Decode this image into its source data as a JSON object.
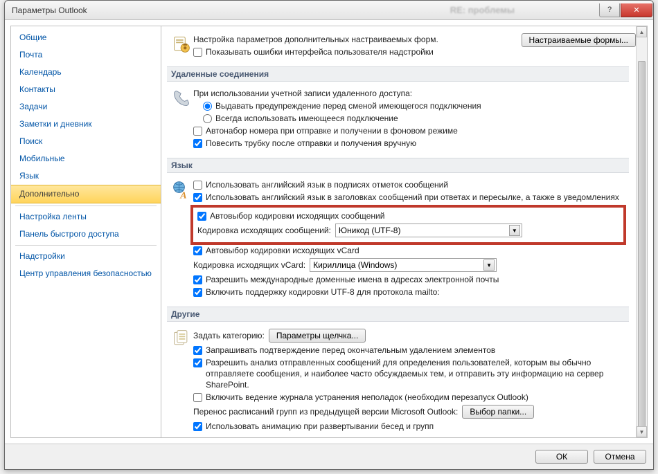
{
  "title": "Параметры Outlook",
  "winbuttons": {
    "help": "?",
    "close": "✕"
  },
  "sidebar": {
    "groups": [
      [
        "Общие",
        "Почта",
        "Календарь",
        "Контакты",
        "Задачи",
        "Заметки и дневник",
        "Поиск",
        "Мобильные",
        "Язык",
        "Дополнительно"
      ],
      [
        "Настройка ленты",
        "Панель быстрого доступа"
      ],
      [
        "Надстройки",
        "Центр управления безопасностью"
      ]
    ],
    "selected": "Дополнительно"
  },
  "topright_button": "Настраиваемые формы...",
  "sections": {
    "forms": {
      "desc": "Настройка параметров дополнительных настраиваемых форм.",
      "show_errors": "Показывать ошибки интерфейса пользователя надстройки"
    },
    "dialup": {
      "header": "Удаленные соединения",
      "lead": "При использовании учетной записи удаленного доступа:",
      "radio1": "Выдавать предупреждение перед сменой имеющегося подключения",
      "radio2": "Всегда использовать имеющееся подключение",
      "chk_autodial": "Автонабор номера при отправке и получении в фоновом режиме",
      "chk_hangup": "Повесить трубку после отправки и получения вручную"
    },
    "lang": {
      "header": "Язык",
      "chk_eng_sig": "Использовать английский язык в подписях отметок сообщений",
      "chk_eng_hdr": "Использовать английский язык в заголовках сообщений при ответах и пересылке, а также в уведомлениях",
      "chk_auto_enc_out": "Автовыбор кодировки исходящих сообщений",
      "lbl_enc_out": "Кодировка исходящих сообщений:",
      "val_enc_out": "Юникод (UTF-8)",
      "chk_auto_enc_vcard": "Автовыбор кодировки исходящих vCard",
      "lbl_enc_vcard": "Кодировка исходящих vCard:",
      "val_enc_vcard": "Кириллица (Windows)",
      "chk_idn": "Разрешить международные доменные имена в адресах электронной почты",
      "chk_utf8_mailto": "Включить поддержку кодировки UTF-8 для протокола mailto:"
    },
    "other": {
      "header": "Другие",
      "lbl_category": "Задать категорию:",
      "btn_click_params": "Параметры щелчка...",
      "chk_confirm_delete": "Запрашивать подтверждение перед окончательным удалением элементов",
      "chk_analysis": "Разрешить анализ отправленных сообщений для определения пользователей, которым вы обычно отправляете сообщения, и наиболее часто обсуждаемых тем, и отправить эту информацию на сервер SharePoint.",
      "chk_troubleshoot_log": "Включить ведение журнала устранения неполадок (необходим перезапуск Outlook)",
      "lbl_migrate": "Перенос расписаний групп из предыдущей версии Microsoft Outlook:",
      "btn_choose_folder": "Выбор папки...",
      "chk_animation": "Использовать анимацию при развертывании бесед и групп"
    }
  },
  "footer": {
    "ok": "ОК",
    "cancel": "Отмена"
  }
}
